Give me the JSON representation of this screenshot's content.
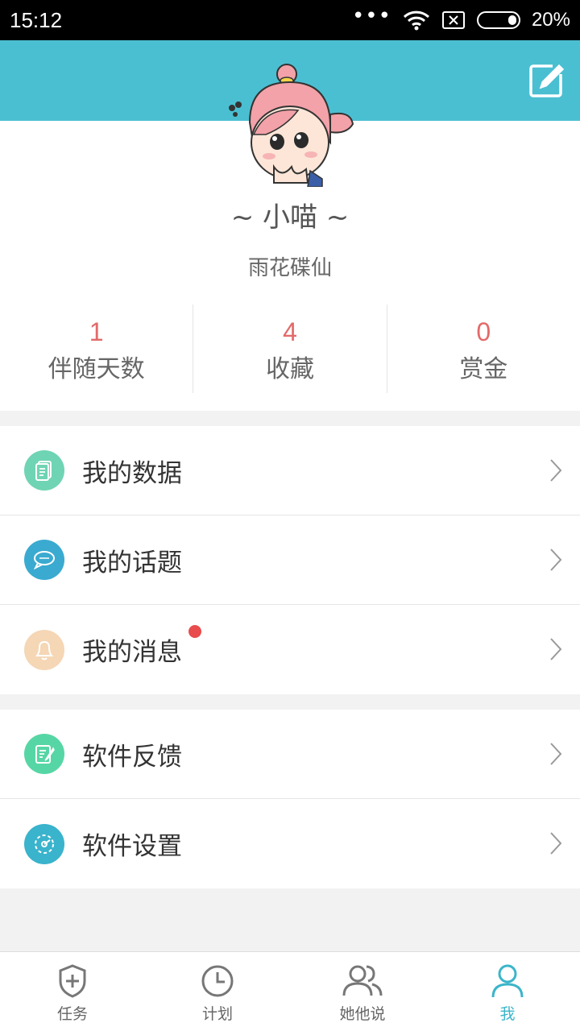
{
  "status_bar": {
    "time": "15:12",
    "dots": "•••",
    "battery_text": "20%"
  },
  "profile": {
    "nickname": "~ 小喵 ~",
    "subtitle": "雨花碟仙",
    "stats": [
      {
        "value": "1",
        "label": "伴随天数"
      },
      {
        "value": "4",
        "label": "收藏"
      },
      {
        "value": "0",
        "label": "赏金"
      }
    ]
  },
  "menu": {
    "group1": [
      {
        "label": "我的数据",
        "icon": "document-icon",
        "color": "#6fd4b3"
      },
      {
        "label": "我的话题",
        "icon": "chat-bubbles-icon",
        "color": "#3aaad0"
      },
      {
        "label": "我的消息",
        "icon": "bell-icon",
        "color": "#f5d6b5"
      }
    ],
    "group2": [
      {
        "label": "软件反馈",
        "icon": "feedback-icon",
        "color": "#57d6a5"
      },
      {
        "label": "软件设置",
        "icon": "settings-dial-icon",
        "color": "#3ab3cc"
      }
    ]
  },
  "tabs": [
    {
      "label": "任务",
      "icon": "shield-plus-icon"
    },
    {
      "label": "计划",
      "icon": "clock-icon"
    },
    {
      "label": "她他说",
      "icon": "people-icon"
    },
    {
      "label": "我",
      "icon": "person-icon",
      "active": true
    }
  ],
  "colors": {
    "header": "#4bbfd2",
    "accent": "#3bb5c9",
    "stat_value": "#e36a6a",
    "notification_dot": "#e84c4c"
  }
}
